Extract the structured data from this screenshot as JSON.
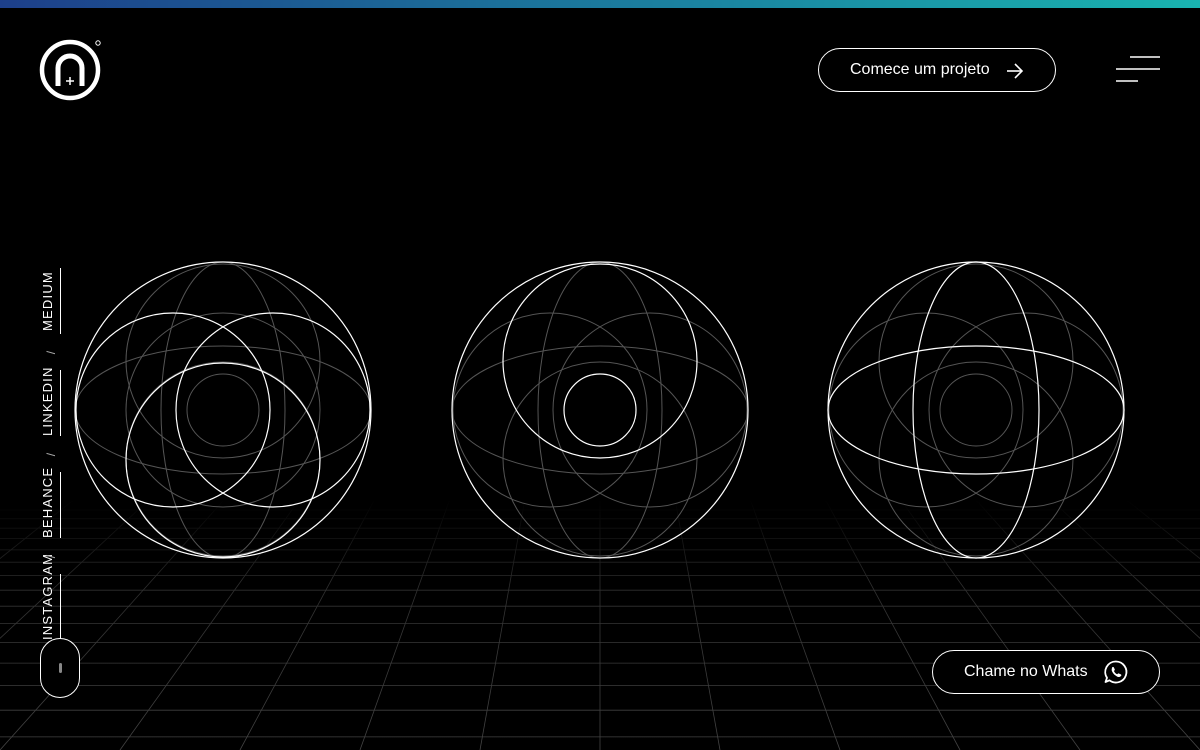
{
  "theme": {
    "background": "#000000",
    "foreground": "#ffffff",
    "gradient_start": "#1d3f8a",
    "gradient_end": "#19b4b0"
  },
  "header": {
    "logo_icon": "brand-logo-icon",
    "cta_label": "Comece um projeto",
    "cta_icon": "arrow-right-icon",
    "menu_icon": "hamburger-menu-icon"
  },
  "social": {
    "links": [
      "INSTAGRAM",
      "BEHANCE",
      "LINKEDIN",
      "MEDIUM"
    ],
    "separator": "/"
  },
  "scroll": {
    "icon": "mouse-scroll-icon"
  },
  "whatsapp": {
    "label": "Chame no Whats",
    "icon": "whatsapp-icon"
  }
}
